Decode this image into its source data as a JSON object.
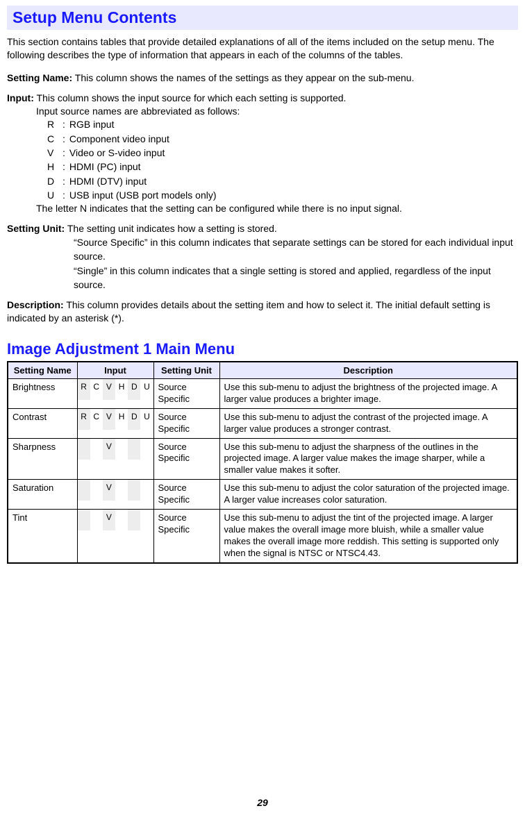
{
  "header": "Setup Menu Contents",
  "intro": "This section contains tables that provide detailed explanations of all of the items included on the setup menu. The following describes the type of information that appears in each of the columns of the tables.",
  "defs": {
    "settingName": {
      "label": "Setting Name:",
      "text": "This column shows the names of the settings as they appear on the sub-menu."
    },
    "input": {
      "label": "Input:",
      "line1": "This column shows the input source for which each setting is supported.",
      "line2": "Input source names are abbreviated as follows:",
      "abbrevs": [
        {
          "code": "R",
          "sep": ":",
          "desc": "RGB input"
        },
        {
          "code": "C",
          "sep": ":",
          "desc": "Component video input"
        },
        {
          "code": "V",
          "sep": ":",
          "desc": "Video or S-video input"
        },
        {
          "code": "H",
          "sep": ":",
          "desc": "HDMI (PC) input"
        },
        {
          "code": "D",
          "sep": ":",
          "desc": "HDMI (DTV) input"
        },
        {
          "code": "U",
          "sep": ":",
          "desc": "USB input (USB port models only)"
        }
      ],
      "line3": "The letter N indicates that the setting can be configured while there is no input signal."
    },
    "settingUnit": {
      "label": "Setting Unit:",
      "line1": "The setting unit indicates how a setting is stored.",
      "line2": "“Source Specific” in this column indicates that separate settings can be stored for each individual input source.",
      "line3": "“Single” in this column indicates that a single setting is stored and applied, regardless of the input source."
    },
    "description": {
      "label": "Description:",
      "text": "This column provides details about the setting item and how to select it. The initial default setting is indicated by an asterisk (*)."
    }
  },
  "subHeader": "Image Adjustment 1 Main Menu",
  "tableHeaders": [
    "Setting Name",
    "Input",
    "Setting Unit",
    "Description"
  ],
  "inputCodes": [
    "R",
    "C",
    "V",
    "H",
    "D",
    "U"
  ],
  "rows": [
    {
      "name": "Brightness",
      "inputs": [
        true,
        true,
        true,
        true,
        true,
        true
      ],
      "unit": "Source Specific",
      "desc": "Use this sub-menu to adjust the brightness of the projected image. A larger value produces a brighter image."
    },
    {
      "name": "Contrast",
      "inputs": [
        true,
        true,
        true,
        true,
        true,
        true
      ],
      "unit": "Source Specific",
      "desc": "Use this sub-menu to adjust the contrast of the projected image. A larger value produces a stronger contrast."
    },
    {
      "name": "Sharpness",
      "inputs": [
        false,
        false,
        true,
        false,
        false,
        false
      ],
      "unit": "Source Specific",
      "desc": "Use this sub-menu to adjust the sharpness of the outlines in the projected image. A larger value makes the image sharper, while a smaller value makes it softer."
    },
    {
      "name": "Saturation",
      "inputs": [
        false,
        false,
        true,
        false,
        false,
        false
      ],
      "unit": "Source Specific",
      "desc": "Use this sub-menu to adjust the color saturation of the projected image. A larger value increases color saturation."
    },
    {
      "name": "Tint",
      "inputs": [
        false,
        false,
        true,
        false,
        false,
        false
      ],
      "unit": "Source Specific",
      "desc": "Use this sub-menu to adjust the tint of the projected image. A larger value makes the overall image more bluish, while a smaller value makes the overall image more reddish. This setting is supported only when the signal is NTSC or NTSC4.43."
    }
  ],
  "pageNumber": "29"
}
